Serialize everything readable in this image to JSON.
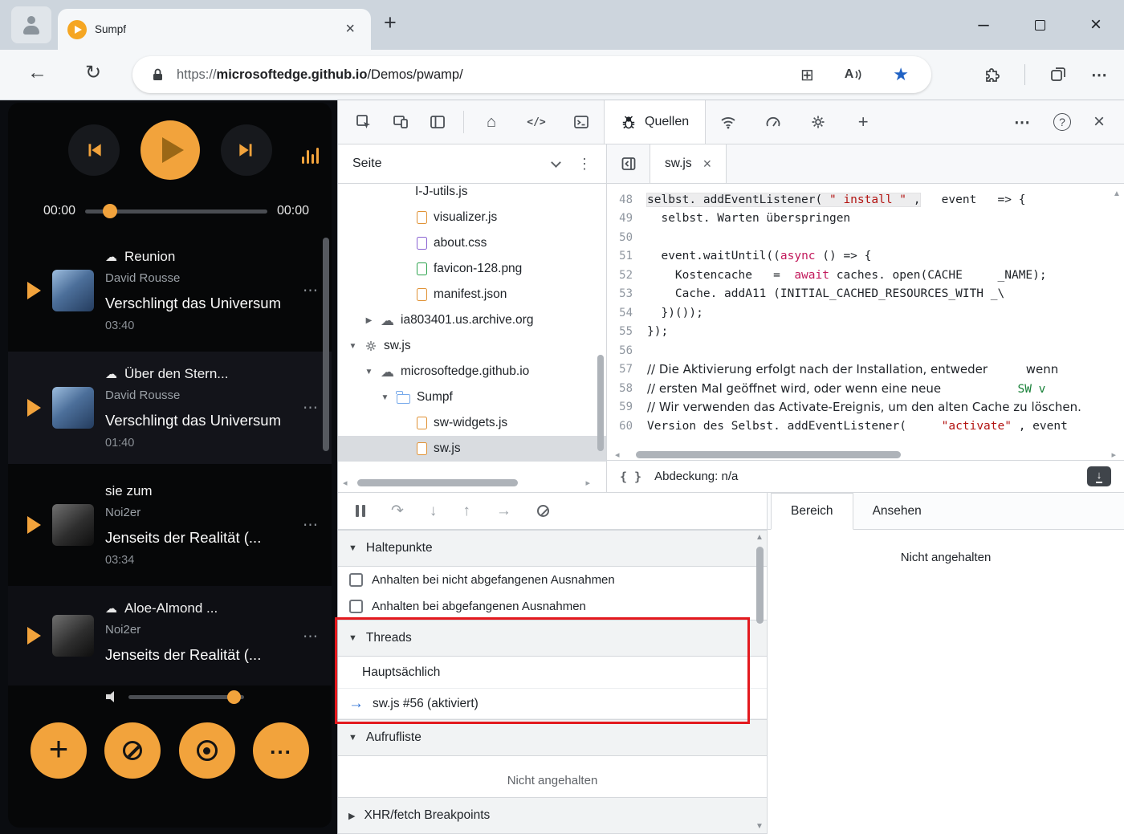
{
  "browser": {
    "tab_title": "Sumpf",
    "url": {
      "scheme": "https://",
      "domain": "microsoftedge.github.io",
      "path": "/Demos/pwamp/"
    }
  },
  "player": {
    "elapsed": "00:00",
    "total": "00:00",
    "tracks": [
      {
        "title": "Reunion",
        "artist": "David Rousse",
        "album": "Verschlingt das Universum",
        "duration": "03:40"
      },
      {
        "title": "Über den Stern...",
        "artist": "David Rousse",
        "album": "Verschlingt das Universum",
        "duration": "01:40"
      },
      {
        "title": "sie zum",
        "artist": "Noi2er",
        "album": "Jenseits der Realität (...",
        "duration": "03:34"
      },
      {
        "title": "Aloe-Almond ...",
        "artist": "Noi2er",
        "album": "Jenseits der Realität (...",
        "duration": ""
      }
    ]
  },
  "devtools": {
    "toolbar": {
      "sources_tab": "Quellen"
    },
    "file_pane": {
      "tab": "Seite",
      "items": [
        {
          "label": "I-J-utils.js"
        },
        {
          "label": "visualizer.js"
        },
        {
          "label": "about.css"
        },
        {
          "label": "favicon-128.png"
        },
        {
          "label": "manifest.json"
        },
        {
          "label": "ia803401.us.archive.org"
        },
        {
          "label": "sw.js"
        },
        {
          "label": "microsoftedge.github.io"
        },
        {
          "label": "Sumpf"
        },
        {
          "label": "sw-widgets.js"
        },
        {
          "label": "sw.js"
        }
      ]
    },
    "editor": {
      "tab": "sw.js",
      "coverage": "Abdeckung: n/a",
      "lines": [
        {
          "n": "48",
          "s": [
            "selbst. addEventListener( ",
            "\" install \"",
            " ,",
            "   event   => {"
          ]
        },
        {
          "n": "49",
          "s": [
            "  selbst. Warten überspringen"
          ]
        },
        {
          "n": "50",
          "s": [
            ""
          ]
        },
        {
          "n": "51",
          "s": [
            "  event.waitUntil((",
            "async",
            " () => {"
          ]
        },
        {
          "n": "52",
          "s": [
            "    Kostencache   =  ",
            "await",
            " caches. open(CACHE",
            "     _NAME);"
          ]
        },
        {
          "n": "53",
          "s": [
            "    Cache. addA11 (INITIAL_CACHED_RESOURCES_WITH _\\"
          ]
        },
        {
          "n": "54",
          "s": [
            "  })());"
          ]
        },
        {
          "n": "55",
          "s": [
            "});"
          ]
        },
        {
          "n": "56",
          "s": [
            ""
          ]
        },
        {
          "n": "57",
          "s": [
            "// Die Aktivierung erfolgt nach der Installation, entweder",
            "          wenn"
          ]
        },
        {
          "n": "58",
          "s": [
            "// ersten Mal geöffnet wird, oder wenn eine neue",
            "                    ",
            "SW v"
          ]
        },
        {
          "n": "59",
          "s": [
            "// Wir verwenden das Activate-Ereignis, um den alten Cache zu löschen."
          ]
        },
        {
          "n": "60",
          "s": [
            "Version des Selbst. addEventListener(",
            "     ",
            "\"activate\"",
            " , event"
          ]
        }
      ]
    },
    "debugger": {
      "breakpoints": {
        "title": "Haltepunkte",
        "options": [
          {
            "label": "Anhalten bei nicht abgefangenen Ausnahmen"
          },
          {
            "label": "Anhalten bei abgefangenen Ausnahmen"
          }
        ]
      },
      "threads": {
        "title": "Threads",
        "main": "Hauptsächlich",
        "worker": "sw.js #56 (aktiviert)"
      },
      "callstack": {
        "title": "Aufrufliste",
        "empty": "Nicht angehalten"
      },
      "xhr": {
        "title": "XHR/fetch Breakpoints"
      },
      "scope": {
        "tab_scope": "Bereich",
        "tab_watch": "Ansehen",
        "empty": "Nicht angehalten"
      }
    }
  },
  "colors": {
    "accent_orange": "#f2a33c",
    "annotation_red": "#e3191e",
    "favorite_blue": "#2062c4",
    "thread_arrow_blue": "#2b6fd4"
  }
}
